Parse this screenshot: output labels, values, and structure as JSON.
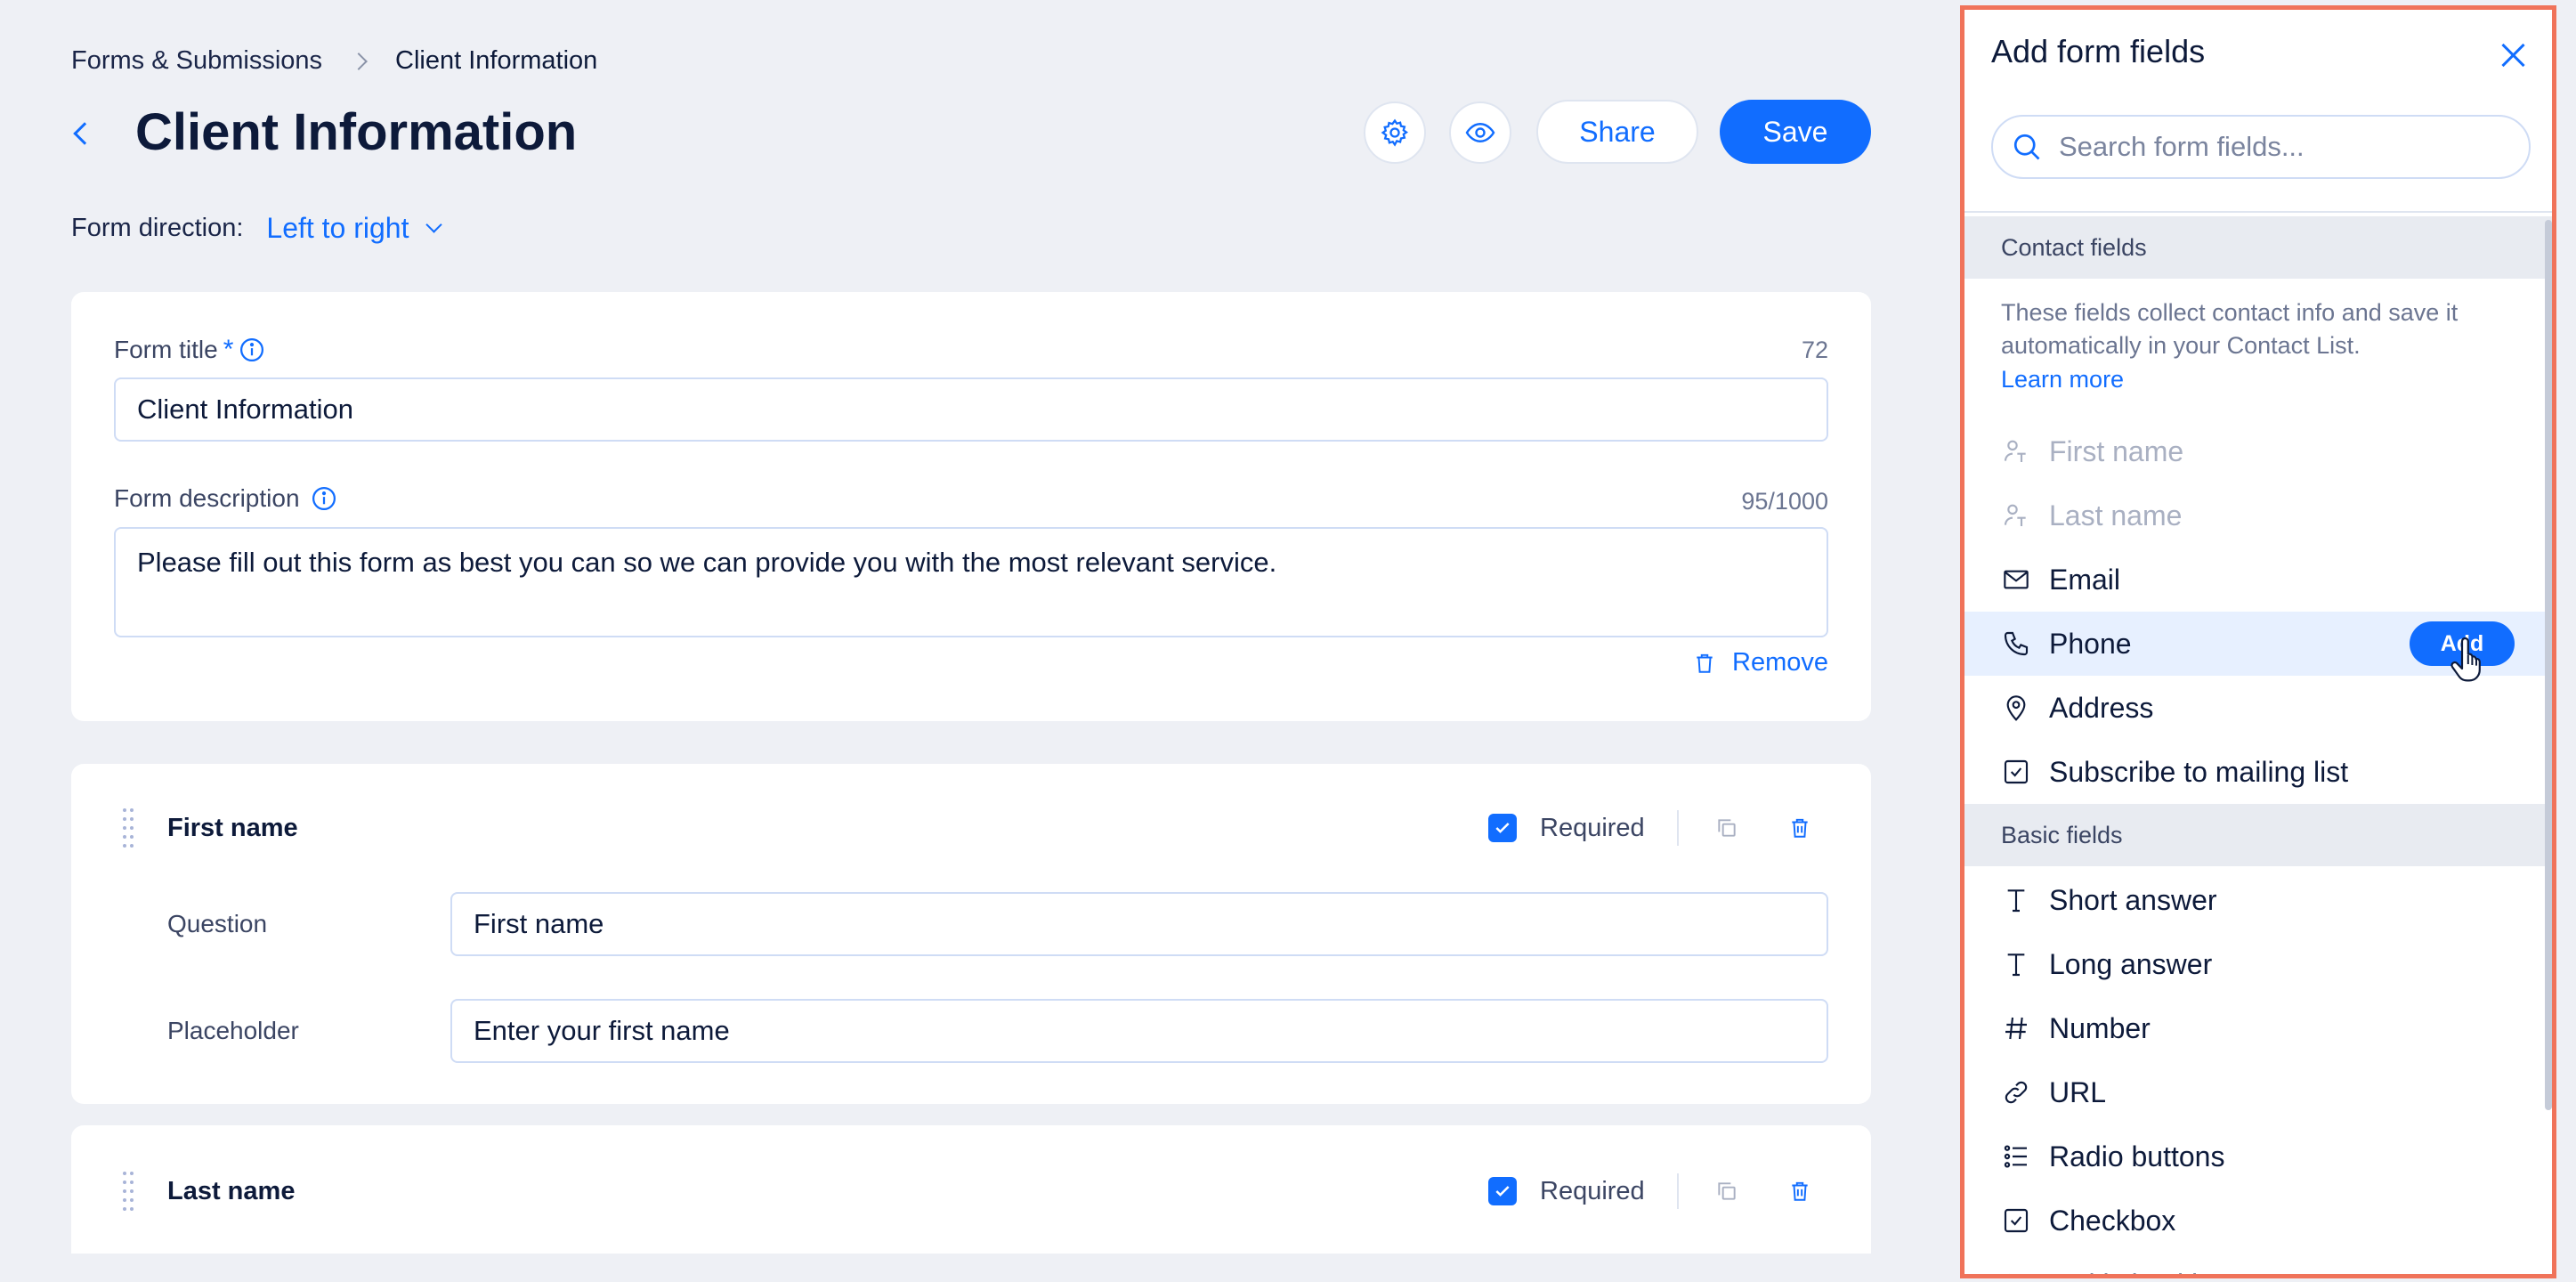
{
  "breadcrumb": {
    "parent": "Forms & Submissions",
    "current": "Client Information"
  },
  "header": {
    "title": "Client Information",
    "share_label": "Share",
    "save_label": "Save"
  },
  "direction": {
    "label": "Form direction:",
    "value": "Left to right"
  },
  "form_title": {
    "label": "Form title",
    "required_mark": "*",
    "counter": "72",
    "value": "Client Information"
  },
  "form_description": {
    "label": "Form description",
    "counter": "95/1000",
    "value": "Please fill out this form as best you can so we can provide you with the most relevant service.",
    "remove_label": "Remove"
  },
  "fields": [
    {
      "name": "First name",
      "required_label": "Required",
      "required": true,
      "question_label": "Question",
      "question_value": "First name",
      "placeholder_label": "Placeholder",
      "placeholder_value": "Enter your first name"
    },
    {
      "name": "Last name",
      "required_label": "Required",
      "required": true
    }
  ],
  "panel": {
    "title": "Add form fields",
    "search_placeholder": "Search form fields...",
    "contact_section": "Contact fields",
    "contact_description": "These fields collect contact info and save it automatically in your Contact List.",
    "learn_more": "Learn more",
    "contact_items": [
      {
        "label": "First name",
        "icon": "person-text-icon",
        "disabled": true
      },
      {
        "label": "Last name",
        "icon": "person-text-icon",
        "disabled": true
      },
      {
        "label": "Email",
        "icon": "envelope-icon",
        "disabled": false
      },
      {
        "label": "Phone",
        "icon": "phone-icon",
        "disabled": false,
        "hovered": true
      },
      {
        "label": "Address",
        "icon": "location-pin-icon",
        "disabled": false
      },
      {
        "label": "Subscribe to mailing list",
        "icon": "checkbox-icon",
        "disabled": false
      }
    ],
    "add_label": "Add",
    "basic_section": "Basic fields",
    "basic_items": [
      {
        "label": "Short answer",
        "icon": "text-t-icon"
      },
      {
        "label": "Long answer",
        "icon": "text-t-icon"
      },
      {
        "label": "Number",
        "icon": "hash-icon"
      },
      {
        "label": "URL",
        "icon": "link-icon"
      },
      {
        "label": "Radio buttons",
        "icon": "list-radio-icon"
      },
      {
        "label": "Checkbox",
        "icon": "checkbox-icon"
      },
      {
        "label": "Multi checkbox",
        "icon": "list-check-icon"
      }
    ]
  },
  "colors": {
    "accent": "#116dff",
    "highlight_border": "#f0735a",
    "background": "#eef0f5"
  }
}
